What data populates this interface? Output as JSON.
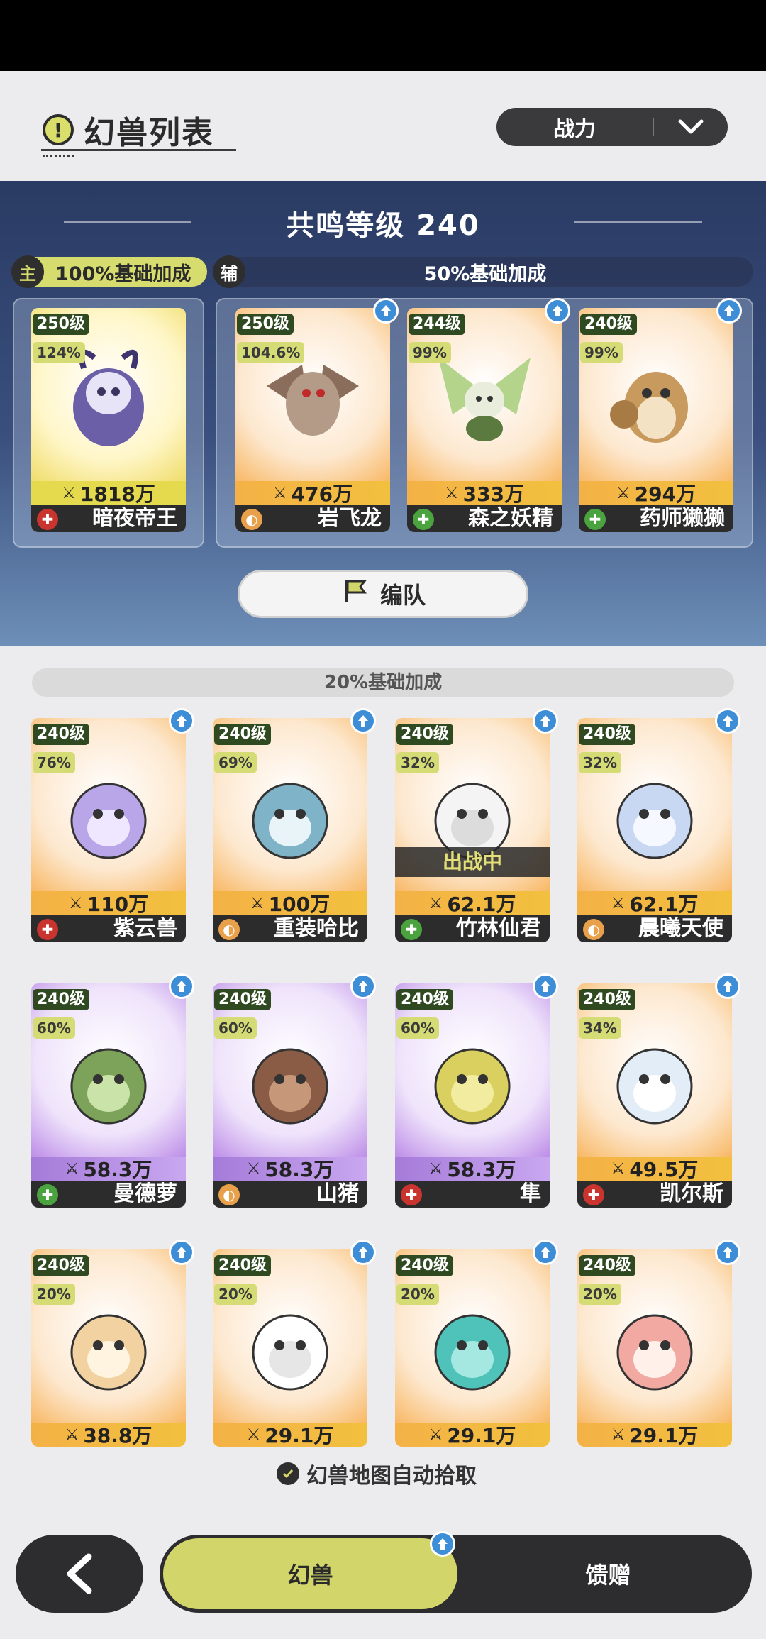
{
  "header": {
    "title": "幻兽列表",
    "sort": {
      "label": "战力"
    }
  },
  "top": {
    "resonance": "共鸣等级 240",
    "main_bar": {
      "tag": "主",
      "text": "100%基础加成"
    },
    "support_bar": {
      "tag": "辅",
      "text": "50%基础加成"
    },
    "main_card": {
      "level": "250级",
      "percent": "124%",
      "power": "1818万",
      "name": "暗夜帝王",
      "class": "attack"
    },
    "support_cards": [
      {
        "level": "250级",
        "percent": "104.6%",
        "power": "476万",
        "name": "岩飞龙",
        "class": "defense",
        "upgrade": true
      },
      {
        "level": "244级",
        "percent": "99%",
        "power": "333万",
        "name": "森之妖精",
        "class": "heal",
        "upgrade": true
      },
      {
        "level": "240级",
        "percent": "99%",
        "power": "294万",
        "name": "药师獭獭",
        "class": "heal",
        "upgrade": true
      }
    ],
    "team_button": "编队"
  },
  "lower": {
    "bar_text": "20%基础加成",
    "cards": [
      {
        "level": "240级",
        "percent": "76%",
        "power": "110万",
        "name": "紫云兽",
        "class": "attack",
        "theme": "orange",
        "upgrade": true
      },
      {
        "level": "240级",
        "percent": "69%",
        "power": "100万",
        "name": "重装哈比",
        "class": "defense",
        "theme": "orange",
        "upgrade": true
      },
      {
        "level": "240级",
        "percent": "32%",
        "power": "62.1万",
        "name": "竹林仙君",
        "class": "heal",
        "theme": "orange",
        "upgrade": true,
        "deployed": "出战中"
      },
      {
        "level": "240级",
        "percent": "32%",
        "power": "62.1万",
        "name": "晨曦天使",
        "class": "defense",
        "theme": "orange",
        "upgrade": true
      },
      {
        "level": "240级",
        "percent": "60%",
        "power": "58.3万",
        "name": "曼德萝",
        "class": "heal",
        "theme": "purple",
        "upgrade": true
      },
      {
        "level": "240级",
        "percent": "60%",
        "power": "58.3万",
        "name": "山猪",
        "class": "defense",
        "theme": "purple",
        "upgrade": true
      },
      {
        "level": "240级",
        "percent": "60%",
        "power": "58.3万",
        "name": "隼",
        "class": "attack",
        "theme": "purple",
        "upgrade": true
      },
      {
        "level": "240级",
        "percent": "34%",
        "power": "49.5万",
        "name": "凯尔斯",
        "class": "attack",
        "theme": "orange",
        "upgrade": true
      },
      {
        "level": "240级",
        "percent": "20%",
        "power": "38.8万",
        "name": "",
        "class": "",
        "theme": "orange",
        "upgrade": true
      },
      {
        "level": "240级",
        "percent": "20%",
        "power": "29.1万",
        "name": "",
        "class": "",
        "theme": "orange",
        "upgrade": true
      },
      {
        "level": "240级",
        "percent": "20%",
        "power": "29.1万",
        "name": "",
        "class": "",
        "theme": "orange",
        "upgrade": true
      },
      {
        "level": "240级",
        "percent": "20%",
        "power": "29.1万",
        "name": "",
        "class": "",
        "theme": "orange",
        "upgrade": true
      }
    ],
    "auto_pick": "幻兽地图自动拾取"
  },
  "bottom_nav": {
    "tabs": [
      {
        "label": "幻兽",
        "active": true
      },
      {
        "label": "馈赠",
        "active": false
      }
    ]
  },
  "icons": {
    "info": "info-icon",
    "chevron": "chevron-down-icon",
    "flag": "flag-icon",
    "upgrade": "up-arrow-icon",
    "back": "back-arrow-icon",
    "check": "check-icon"
  },
  "colors": {
    "accent": "#d2d56a",
    "dark": "#2d2d2f",
    "attack": "#c9342e",
    "defense": "#e9a04a",
    "heal": "#4aa33e",
    "upgrade": "#3d8ed6"
  }
}
